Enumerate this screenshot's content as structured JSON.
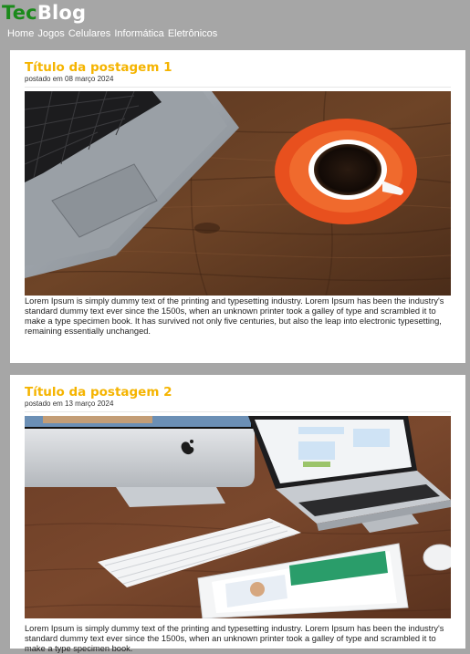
{
  "site": {
    "logo_part1": "Tec",
    "logo_part2": "Blog",
    "accent_green": "#1a8a1a",
    "title_color": "#f5b400",
    "page_background": "#a6a6a6"
  },
  "nav": {
    "items": [
      "Home",
      "Jogos",
      "Celulares",
      "Informática",
      "Eletrônicos"
    ]
  },
  "posts": [
    {
      "title": "Título da postagem 1",
      "date": "postado em 08 março 2024",
      "image": "laptop-and-coffee-photo",
      "body": "Lorem Ipsum is simply dummy text of the printing and typesetting industry. Lorem Ipsum has been the industry's standard dummy text ever since the 1500s, when an unknown printer took a galley of type and scrambled it to make a type specimen book. It has survived not only five centuries, but also the leap into electronic typesetting, remaining essentially unchanged."
    },
    {
      "title": "Título da postagem 2",
      "date": "postado em 13 março 2024",
      "image": "desk-devices-photo",
      "body": "Lorem Ipsum is simply dummy text of the printing and typesetting industry. Lorem Ipsum has been the industry's standard dummy text ever since the 1500s, when an unknown printer took a galley of type and scrambled it to make a type specimen book."
    }
  ]
}
